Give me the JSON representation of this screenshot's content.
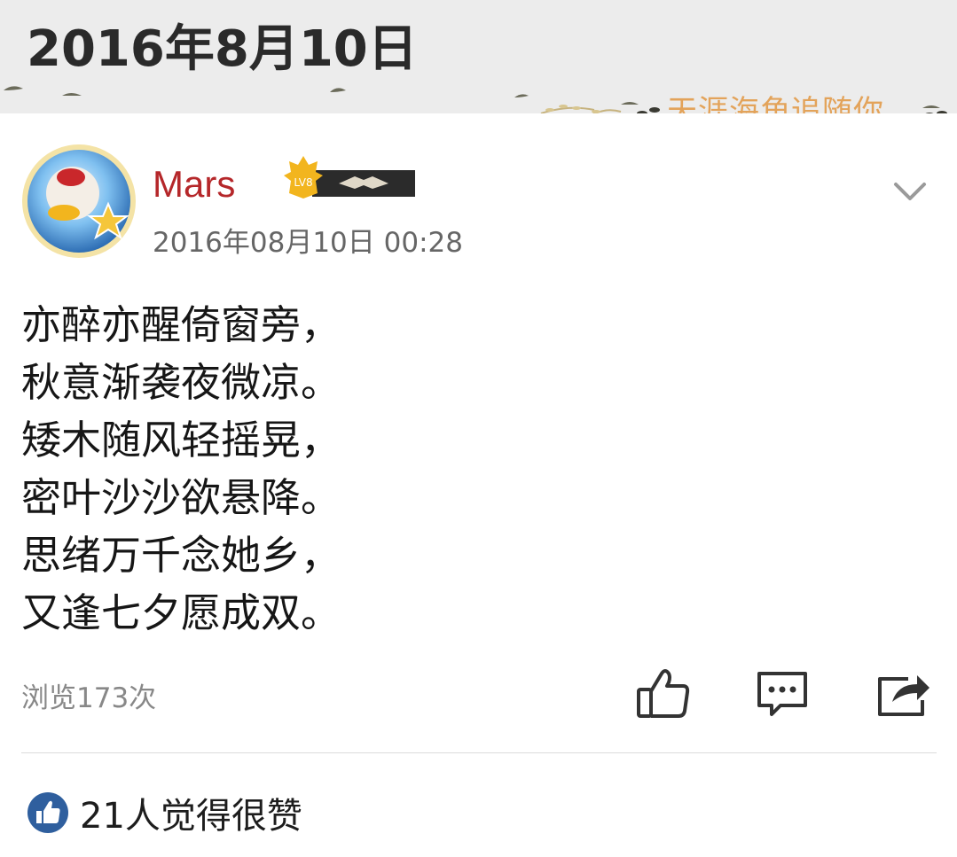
{
  "header": {
    "date_title": "2016年8月10日",
    "banner_text": "天涯海角追随你"
  },
  "post": {
    "author": "Mars",
    "level_badge": "LV8",
    "timestamp": "2016年08月10日 00:28",
    "poem_lines": [
      "亦醉亦醒倚窗旁，",
      "秋意渐袭夜微凉。",
      "矮木随风轻摇晃，",
      "密叶沙沙欲悬降。",
      "思绪万千念她乡，",
      "又逢七夕愿成双。"
    ],
    "views": "浏览173次",
    "likes_summary": "21人觉得很赞"
  },
  "icons": {
    "more": "chevron-down-icon",
    "like": "thumbs-up-icon",
    "comment": "comment-icon",
    "share": "share-icon",
    "likes_badge": "thumbs-up-badge-icon"
  },
  "colors": {
    "username": "#b5272a",
    "header_bg": "#ececec",
    "banner_text": "#e3a35a",
    "likes_badge": "#2f5f9e"
  }
}
